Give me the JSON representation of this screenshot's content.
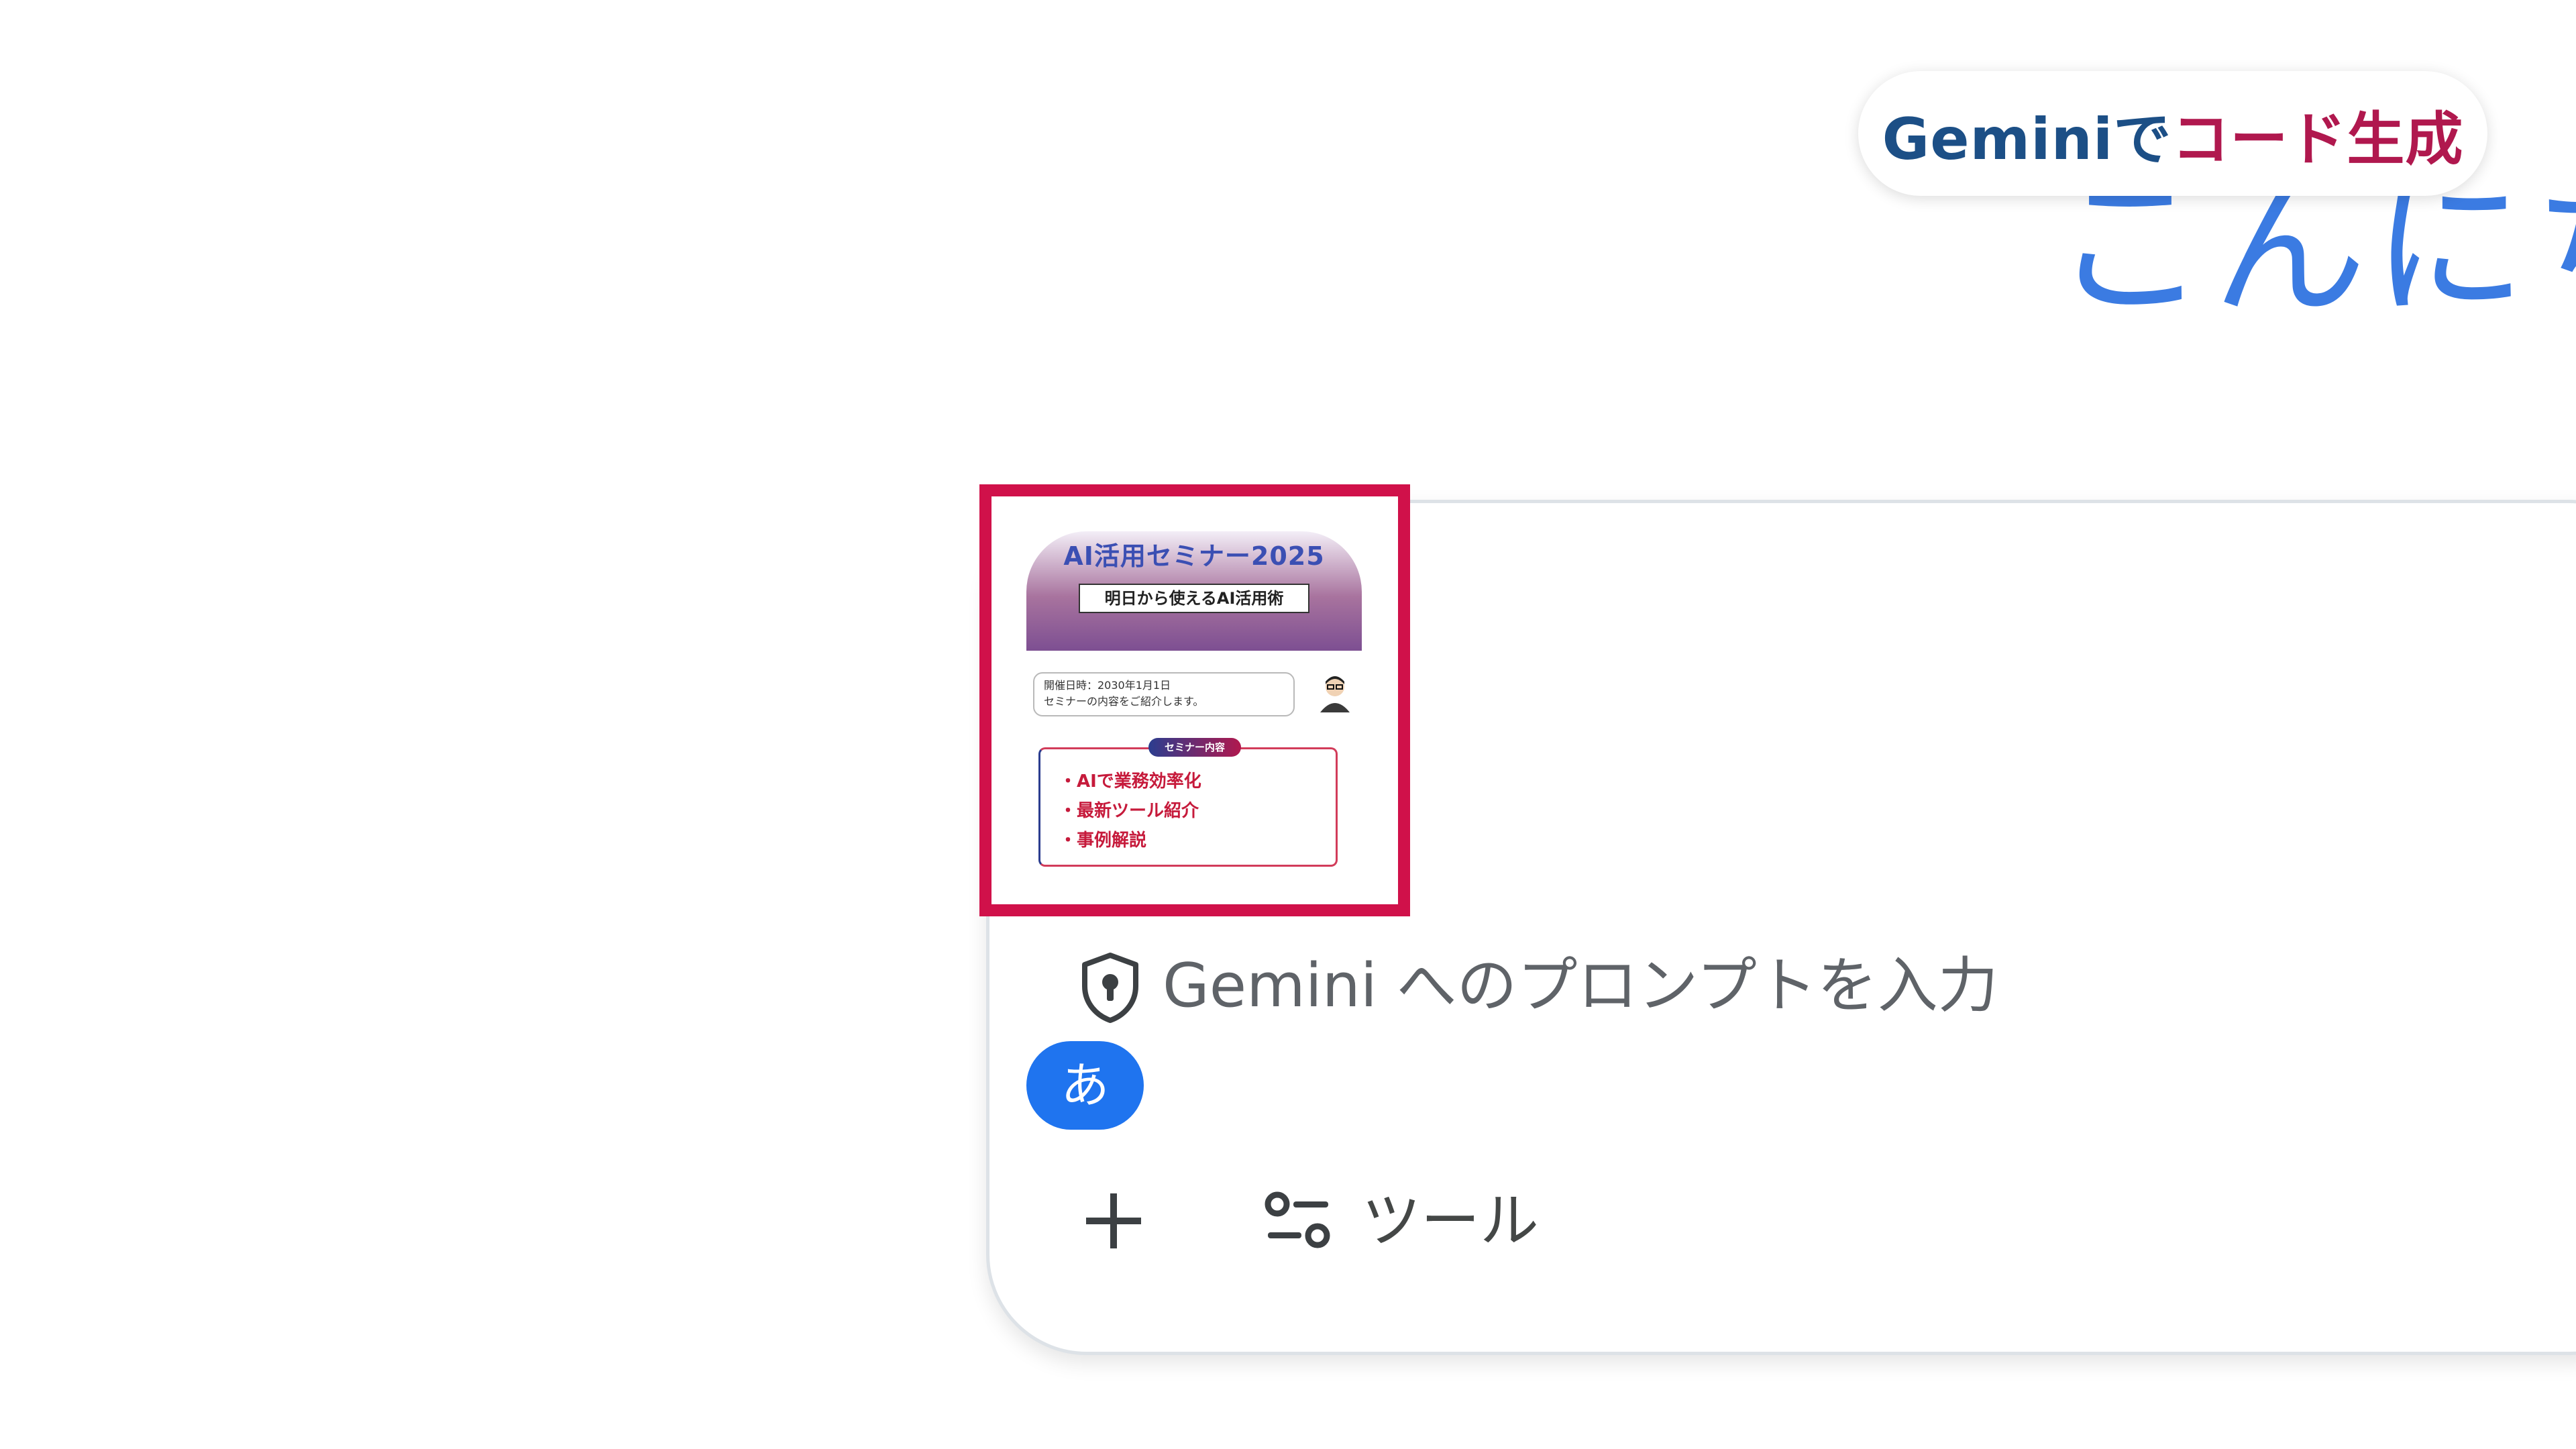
{
  "badge": {
    "part1": "Geminiで",
    "part2": "コード生成",
    "color1": "#1c4f86",
    "color2": "#b0184e"
  },
  "greeting": "こんにち",
  "attachment": {
    "title": "AI活用セミナー2025",
    "subtitle": "明日から使えるAI活用術",
    "info_line1": "開催日時：2030年1月1日",
    "info_line2": "セミナーの内容をご紹介します。",
    "pill": "セミナー内容",
    "items": [
      "・AIで業務効率化",
      "・最新ツール紹介",
      "・事例解説"
    ],
    "highlight_color": "#d0114a"
  },
  "prompt": {
    "placeholder": "Gemini へのプロンプトを入力",
    "security_icon": "shield-lock-icon"
  },
  "ime": {
    "label": "あ",
    "color": "#1f74ef"
  },
  "toolbar": {
    "add_icon": "plus-icon",
    "tools_icon": "tune-icon",
    "tools_label": "ツール"
  }
}
